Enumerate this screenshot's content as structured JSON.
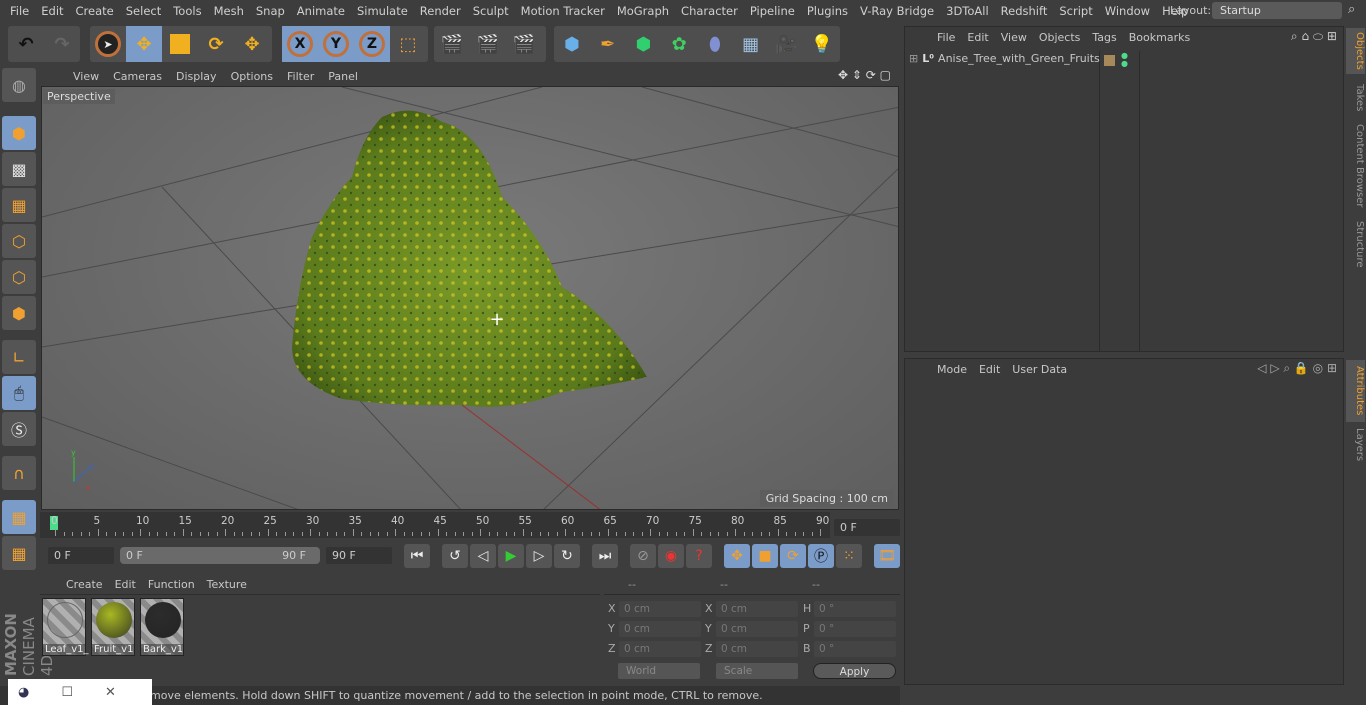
{
  "menu": [
    "File",
    "Edit",
    "Create",
    "Select",
    "Tools",
    "Mesh",
    "Snap",
    "Animate",
    "Simulate",
    "Render",
    "Sculpt",
    "Motion Tracker",
    "MoGraph",
    "Character",
    "Pipeline",
    "Plugins",
    "V-Ray Bridge",
    "3DToAll",
    "Redshift",
    "Script",
    "Window",
    "Help"
  ],
  "layout": {
    "label": "Layout:",
    "value": "Startup"
  },
  "axes": {
    "x": "X",
    "y": "Y",
    "z": "Z"
  },
  "viewport": {
    "menu": [
      "View",
      "Cameras",
      "Display",
      "Options",
      "Filter",
      "Panel"
    ],
    "camera": "Perspective",
    "grid_spacing": "Grid Spacing : 100 cm"
  },
  "timeline": {
    "ticks": [
      "0",
      "5",
      "10",
      "15",
      "20",
      "25",
      "30",
      "35",
      "40",
      "45",
      "50",
      "55",
      "60",
      "65",
      "70",
      "75",
      "80",
      "85",
      "90"
    ],
    "current_frame": "0 F",
    "start": "0 F",
    "range_start": "0 F",
    "range_end": "90 F",
    "end": "90 F"
  },
  "materials": {
    "menu": [
      "Create",
      "Edit",
      "Function",
      "Texture"
    ],
    "items": [
      {
        "name": "Leaf_v1_",
        "color": "transparent"
      },
      {
        "name": "Fruit_v1",
        "color": "#a8b822"
      },
      {
        "name": "Bark_v1",
        "color": "#2c2c2c"
      }
    ]
  },
  "coords": {
    "headers": [
      "--",
      "--",
      "--"
    ],
    "rows": [
      {
        "l1": "X",
        "v1": "0 cm",
        "l2": "X",
        "v2": "0 cm",
        "l3": "H",
        "v3": "0 °"
      },
      {
        "l1": "Y",
        "v1": "0 cm",
        "l2": "Y",
        "v2": "0 cm",
        "l3": "P",
        "v3": "0 °"
      },
      {
        "l1": "Z",
        "v1": "0 cm",
        "l2": "Z",
        "v2": "0 cm",
        "l3": "B",
        "v3": "0 °"
      }
    ],
    "mode": "World",
    "transform": "Scale",
    "apply": "Apply"
  },
  "status": "move elements. Hold down SHIFT to quantize movement / add to the selection in point mode, CTRL to remove.",
  "objects": {
    "menu": [
      "File",
      "Edit",
      "View",
      "Objects",
      "Tags",
      "Bookmarks"
    ],
    "items": [
      {
        "name": "Anise_Tree_with_Green_Fruits",
        "tag_color": "#a88a5a"
      }
    ]
  },
  "attributes": {
    "menu": [
      "Mode",
      "Edit",
      "User Data"
    ]
  },
  "side_tabs": {
    "objects": "Objects",
    "takes": "Takes",
    "content_browser": "Content Browser",
    "structure": "Structure",
    "attributes": "Attributes",
    "layers": "Layers"
  },
  "brand": {
    "maxon": "MAXON",
    "product": "CINEMA 4D"
  },
  "colors": {
    "accent": "#7b9bc8",
    "timeline_marker": "#4cdc8c",
    "foliage": "#6a8a25"
  }
}
